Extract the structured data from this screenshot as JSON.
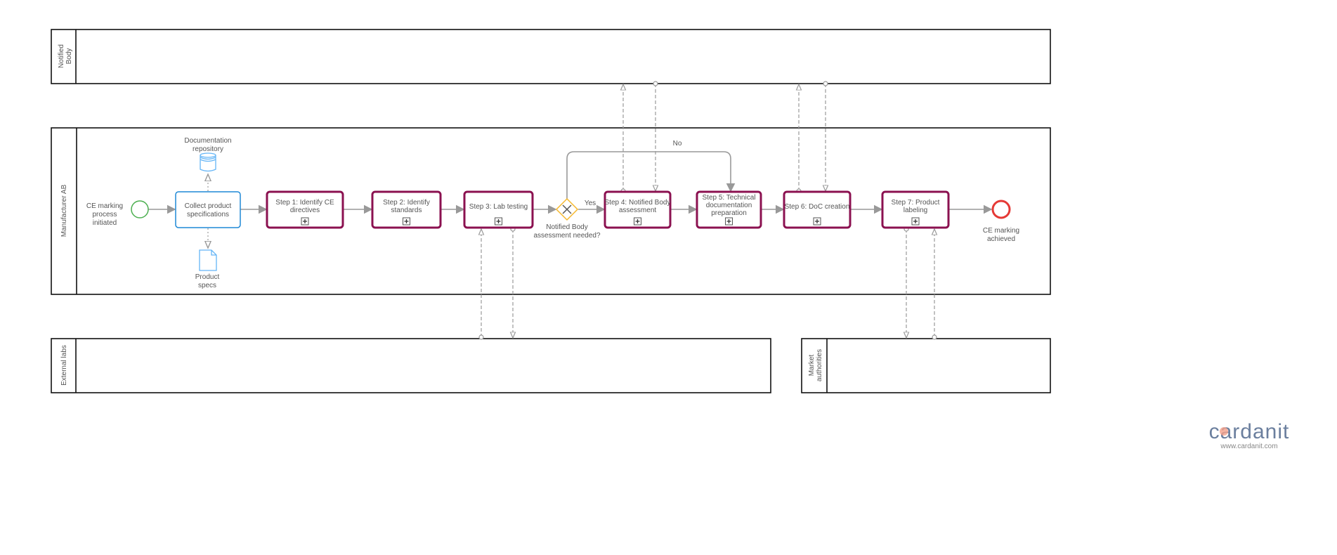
{
  "pools": [
    {
      "id": "notified",
      "label": "Notified Body"
    },
    {
      "id": "manufacturer",
      "label": "Manufacturer AB"
    },
    {
      "id": "labs",
      "label": "External labs"
    },
    {
      "id": "market",
      "label": "Market authorities"
    }
  ],
  "start_event": {
    "label_lines": [
      "CE marking",
      "process",
      "initiated"
    ]
  },
  "end_event": {
    "label_lines": [
      "CE marking",
      "achieved"
    ]
  },
  "data_store": {
    "label_lines": [
      "Documentation",
      "repository"
    ]
  },
  "data_object": {
    "label_lines": [
      "Product",
      "specs"
    ]
  },
  "collect_task": {
    "label_lines": [
      "Collect product",
      "specifications"
    ]
  },
  "subprocesses": [
    {
      "label_lines": [
        "Step 1: Identify CE",
        "directives"
      ]
    },
    {
      "label_lines": [
        "Step 2: Identify",
        "standards"
      ]
    },
    {
      "label_lines": [
        "Step 3: Lab testing"
      ]
    },
    {
      "label_lines": [
        "Step 4: Notified Body",
        "assessment"
      ]
    },
    {
      "label_lines": [
        "Step 5: Technical",
        "documentation",
        "preparation"
      ]
    },
    {
      "label_lines": [
        "Step 6: DoC creation"
      ]
    },
    {
      "label_lines": [
        "Step 7: Product",
        "labeling"
      ]
    }
  ],
  "gateway": {
    "label_lines": [
      "Notified Body",
      "assessment needed?"
    ],
    "yes": "Yes",
    "no": "No"
  },
  "colors": {
    "subprocess": "#8b1150",
    "task": "#1e88d6",
    "start": "#4caf50",
    "end": "#e53935",
    "gateway": "#f5b82e",
    "data": "#64b5f6"
  },
  "logo": {
    "brand": "cardanit",
    "url": "www.cardanit.com"
  }
}
